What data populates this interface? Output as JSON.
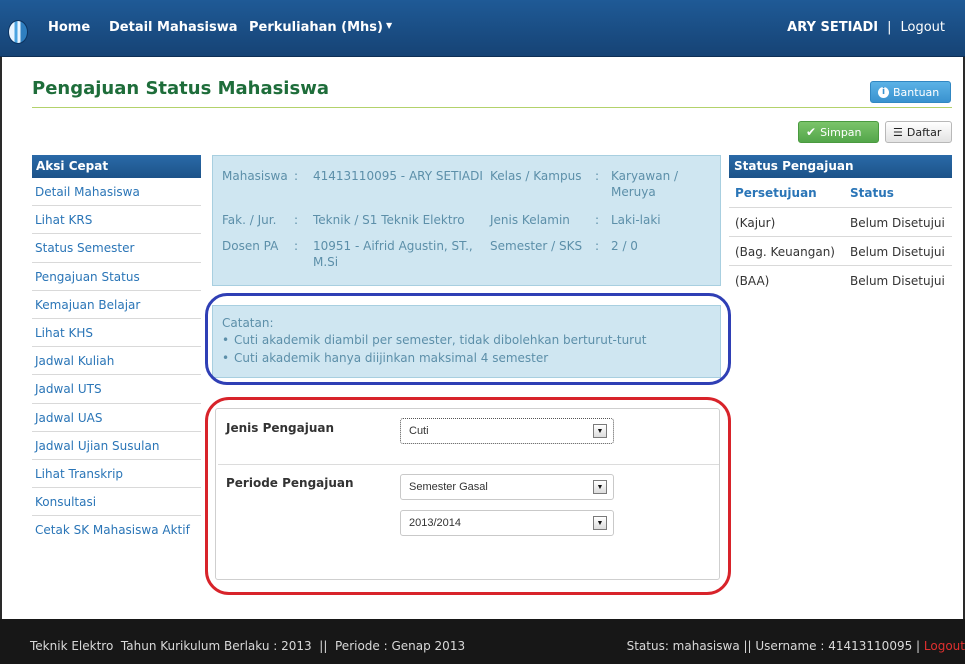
{
  "navbar": {
    "items": [
      "Home",
      "Detail Mahasiswa",
      "Perkuliahan (Mhs)"
    ],
    "user": "ARY SETIADI",
    "separator": "|",
    "logout": "Logout"
  },
  "page": {
    "title": "Pengajuan Status Mahasiswa",
    "help_label": "Bantuan",
    "save_label": "Simpan",
    "list_label": "Daftar"
  },
  "sidebar": {
    "title": "Aksi Cepat",
    "items": [
      "Detail Mahasiswa",
      "Lihat KRS",
      "Status Semester",
      "Pengajuan Status",
      "Kemajuan Belajar",
      "Lihat KHS",
      "Jadwal Kuliah",
      "Jadwal UTS",
      "Jadwal UAS",
      "Jadwal Ujian Susulan",
      "Lihat Transkrip",
      "Konsultasi",
      "Cetak SK Mahasiswa Aktif"
    ]
  },
  "info": {
    "colon": ":",
    "mahasiswa_label": "Mahasiswa",
    "mahasiswa_value": "41413110095 - ARY SETIADI",
    "fak_label": "Fak. / Jur.",
    "fak_value": "Teknik / S1 Teknik Elektro",
    "dosen_label": "Dosen PA",
    "dosen_value_line1": "10951 - Aifrid Agustin, ST.,",
    "dosen_value_line2": "M.Si",
    "kelas_label": "Kelas / Kampus",
    "kelas_value_line1": "Karyawan /",
    "kelas_value_line2": "Meruya",
    "gender_label": "Jenis Kelamin",
    "gender_value": "Laki-laki",
    "semester_label": "Semester / SKS",
    "semester_value": "2 / 0"
  },
  "catatan": {
    "label": "Catatan:",
    "items": [
      "Cuti akademik diambil per semester, tidak dibolehkan berturut-turut",
      "Cuti akademik hanya diijinkan maksimal 4 semester"
    ]
  },
  "form": {
    "jenis_label": "Jenis Pengajuan",
    "jenis_value": "Cuti",
    "periode_label": "Periode Pengajuan",
    "periode_semester_value": "Semester Gasal",
    "periode_tahun_value": "2013/2014"
  },
  "status": {
    "title": "Status Pengajuan",
    "col_persetujuan": "Persetujuan",
    "col_status": "Status",
    "rows": [
      {
        "persetujuan": "(Kajur)",
        "status": "Belum Disetujui"
      },
      {
        "persetujuan": "(Bag. Keuangan)",
        "status": "Belum Disetujui"
      },
      {
        "persetujuan": "(BAA)",
        "status": "Belum Disetujui"
      }
    ]
  },
  "footer": {
    "left": "Teknik Elektro  Tahun Kurikulum Berlaku : 2013  ||  Periode : Genap 2013",
    "right": "Status: mahasiswa || Username : 41413110095 | ",
    "logout": "Logout"
  },
  "colors": {
    "navbar": "#1b4f86",
    "title_green": "#1e6d3a",
    "link_blue": "#2a75b7",
    "info_bg": "#cfe6f1",
    "annotation_blue": "#2f3fb5",
    "annotation_red": "#d8232a",
    "footer": "#171717"
  }
}
